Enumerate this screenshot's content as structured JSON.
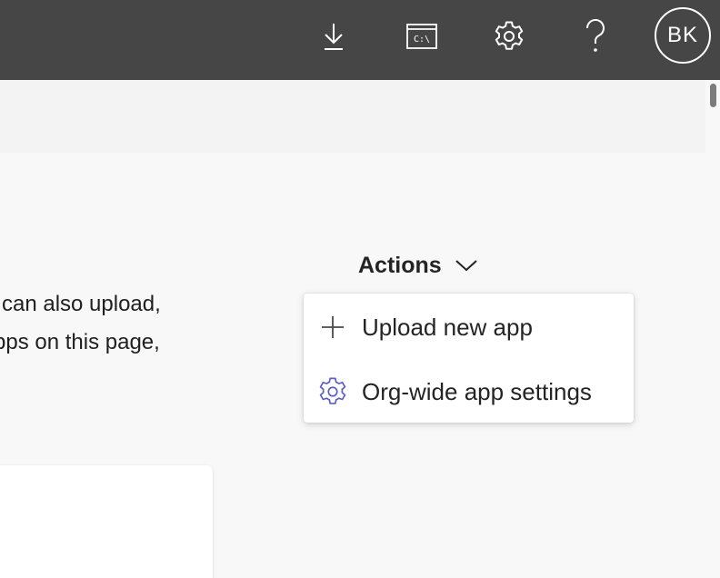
{
  "header": {
    "avatar_initials": "BK",
    "icons": [
      "download-icon",
      "console-icon",
      "settings-icon",
      "help-icon"
    ],
    "console_glyph": "C:\\"
  },
  "description": {
    "line1": "can also upload,",
    "line2": "pps on this page,"
  },
  "actions": {
    "label": "Actions",
    "menu": [
      {
        "label": "Upload new app",
        "icon": "plus-icon"
      },
      {
        "label": "Org-wide app settings",
        "icon": "gear-icon"
      }
    ]
  },
  "colors": {
    "header_bg": "#464646",
    "accent": "#5b5fc7",
    "page_bg": "#f8f8f8"
  }
}
